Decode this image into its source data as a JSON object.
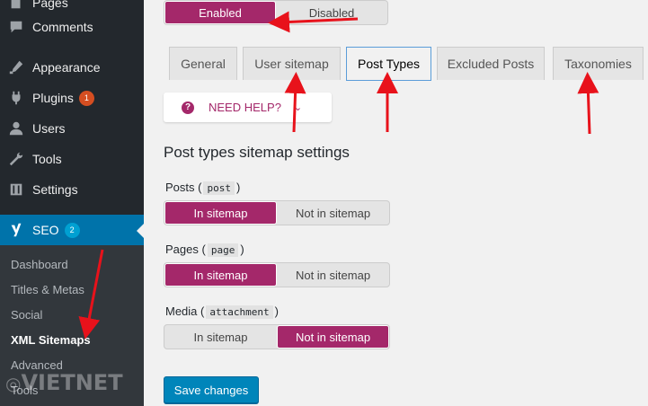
{
  "sidebar": {
    "items": [
      {
        "label": "Pages",
        "icon": "pages-icon"
      },
      {
        "label": "Comments",
        "icon": "comments-icon"
      },
      {
        "label": "Appearance",
        "icon": "appearance-icon"
      },
      {
        "label": "Plugins",
        "icon": "plugins-icon",
        "badge": "1"
      },
      {
        "label": "Users",
        "icon": "users-icon"
      },
      {
        "label": "Tools",
        "icon": "tools-icon"
      },
      {
        "label": "Settings",
        "icon": "settings-icon"
      },
      {
        "label": "SEO",
        "icon": "yoast-icon",
        "badge": "2"
      }
    ],
    "submenu": [
      "Dashboard",
      "Titles & Metas",
      "Social",
      "XML Sitemaps",
      "Advanced",
      "Tools"
    ],
    "watermark": "VIETNET"
  },
  "feature_toggle": {
    "on": "Enabled",
    "off": "Disabled"
  },
  "tabs": [
    "General",
    "User sitemap",
    "Post Types",
    "Excluded Posts",
    "Taxonomies"
  ],
  "help": {
    "label": "NEED HELP?",
    "icon": "question-icon"
  },
  "section_title": "Post types sitemap settings",
  "fields": [
    {
      "label": "Posts",
      "code": "post",
      "options": [
        "In sitemap",
        "Not in sitemap"
      ],
      "selected": "In sitemap"
    },
    {
      "label": "Pages",
      "code": "page",
      "options": [
        "In sitemap",
        "Not in sitemap"
      ],
      "selected": "In sitemap"
    },
    {
      "label": "Media",
      "code": "attachment",
      "options": [
        "In sitemap",
        "Not in sitemap"
      ],
      "selected": "Not in sitemap"
    }
  ],
  "save_label": "Save changes",
  "colors": {
    "accent": "#a4286a",
    "sidebar": "#23282d",
    "active": "#0073aa",
    "button": "#0085ba",
    "annotation": "#e8121b"
  }
}
